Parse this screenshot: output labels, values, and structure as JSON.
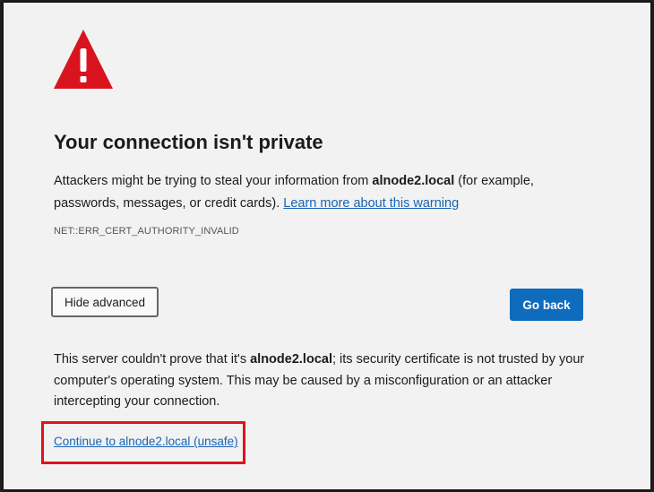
{
  "page": {
    "icon": "warning-triangle-icon",
    "title": "Your connection isn't private",
    "desc_prefix": "Attackers might be trying to steal your information from ",
    "host": "alnode2.local",
    "desc_suffix": " (for example, passwords, messages, or credit cards). ",
    "learn_more": "Learn more about this warning",
    "error_code": "NET::ERR_CERT_AUTHORITY_INVALID",
    "hide_advanced": "Hide advanced",
    "go_back": "Go back",
    "details_prefix": "This server couldn't prove that it's ",
    "details_host": "alnode2.local",
    "details_suffix": "; its security certificate is not trusted by your computer's operating system. This may be caused by a misconfiguration or an attacker intercepting your connection.",
    "proceed_link": "Continue to alnode2.local (unsafe)"
  },
  "colors": {
    "warning_red": "#d9141e",
    "accent_blue": "#0f6cbd",
    "link_blue": "#1764b5",
    "annotation_red": "#e0121d"
  }
}
